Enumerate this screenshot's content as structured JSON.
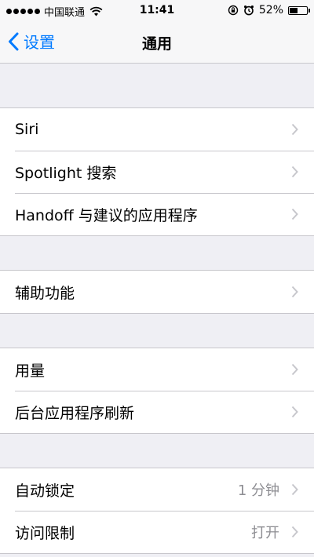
{
  "status_bar": {
    "carrier": "中国联通",
    "time": "11:41",
    "battery_percent": "52%",
    "battery_level": 0.52,
    "icons": [
      "signal-dots-icon",
      "wifi-icon",
      "orientation-lock-icon",
      "alarm-icon",
      "battery-icon"
    ]
  },
  "nav": {
    "back_label": "设置",
    "title": "通用"
  },
  "groups": [
    {
      "items": [
        {
          "label": "Siri"
        },
        {
          "label": "Spotlight 搜索"
        },
        {
          "label": "Handoff 与建议的应用程序"
        }
      ]
    },
    {
      "items": [
        {
          "label": "辅助功能"
        }
      ]
    },
    {
      "items": [
        {
          "label": "用量"
        },
        {
          "label": "后台应用程序刷新"
        }
      ]
    },
    {
      "items": [
        {
          "label": "自动锁定",
          "value": "1 分钟"
        },
        {
          "label": "访问限制",
          "value": "打开"
        }
      ]
    }
  ],
  "colors": {
    "accent": "#007aff",
    "background": "#efeff4",
    "separator": "#c8c7cc",
    "secondary_text": "#8e8e93",
    "chevron": "#c7c7cc"
  }
}
